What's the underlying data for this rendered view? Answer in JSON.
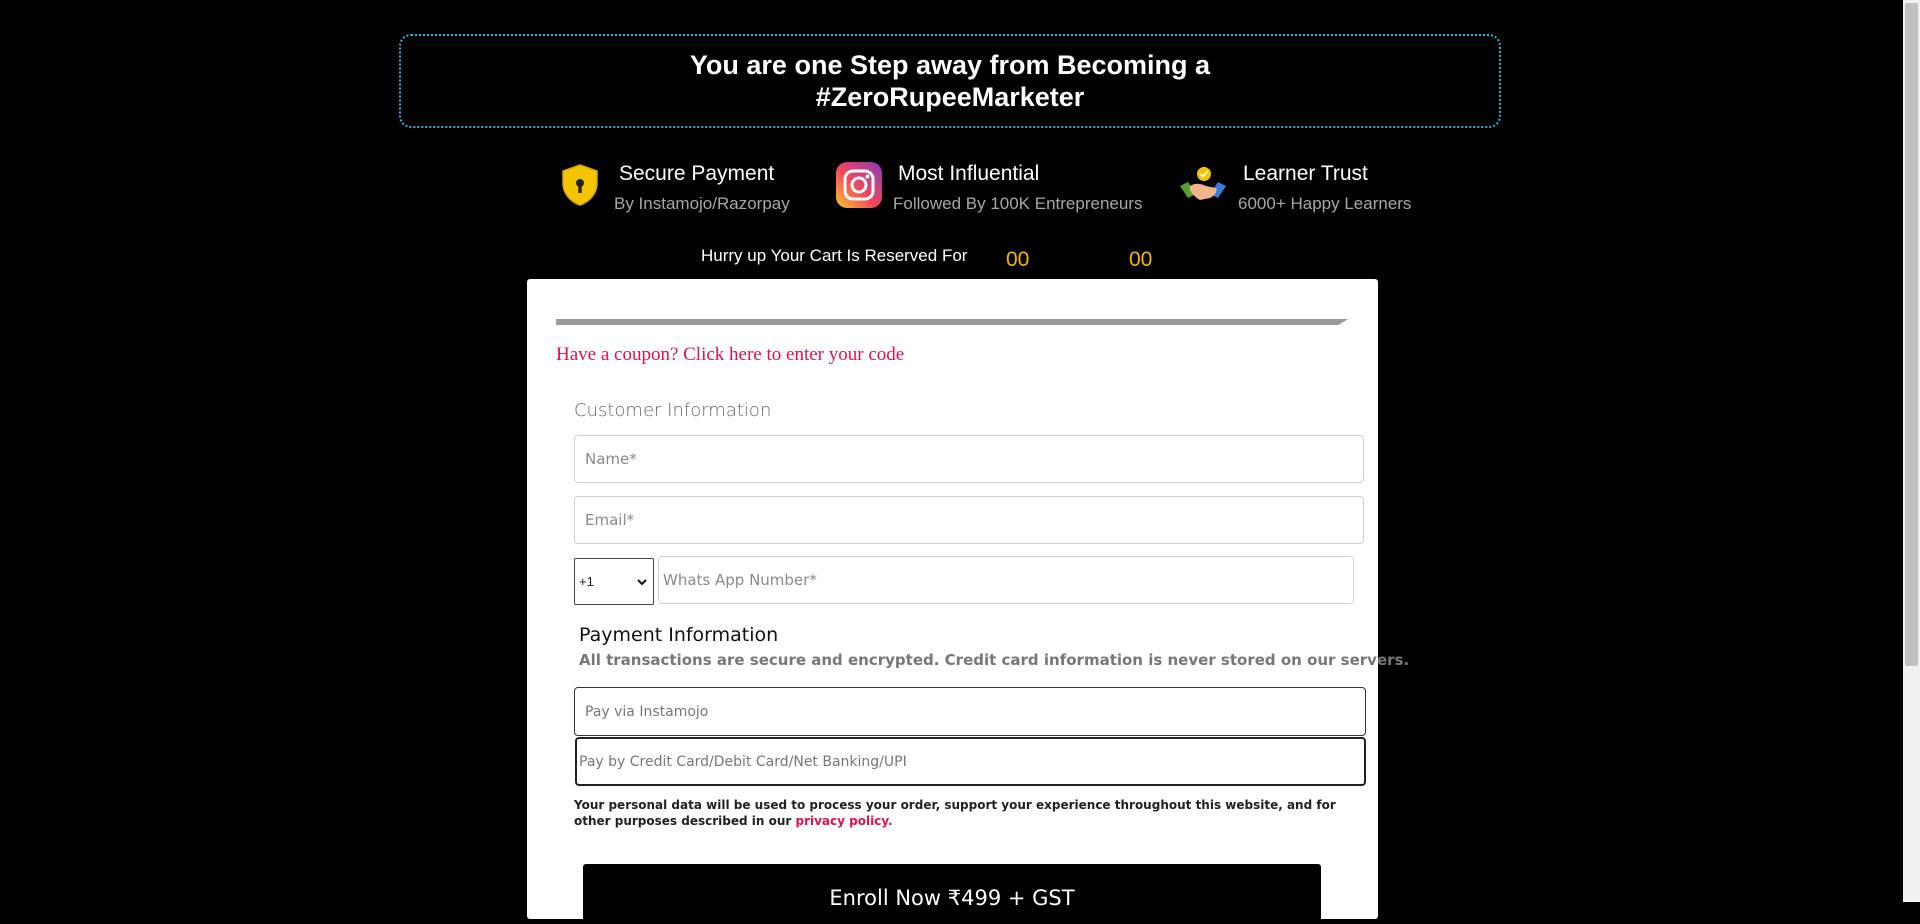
{
  "headline": {
    "line1": "You are one Step away from Becoming a",
    "line2": "#ZeroRupeeMarketer"
  },
  "badges": [
    {
      "icon": "shield-lock-icon",
      "title": "Secure Payment",
      "subtitle": "By Instamojo/Razorpay"
    },
    {
      "icon": "instagram-icon",
      "title": "Most Influential",
      "subtitle": "Followed By 100K Entrepreneurs"
    },
    {
      "icon": "handshake-icon",
      "title": "Learner Trust",
      "subtitle": "6000+ Happy Learners"
    }
  ],
  "timer": {
    "label": "Hurry up Your Cart Is Reserved For",
    "minutes": "00",
    "seconds": "00"
  },
  "coupon_text": "Have a coupon? Click here to enter your code",
  "customer": {
    "title": "Customer Information",
    "name_placeholder": "Name*",
    "email_placeholder": "Email*",
    "country_code": "+1",
    "whatsapp_placeholder": "Whats App Number*"
  },
  "payment": {
    "title": "Payment Information",
    "subtitle": "All transactions are secure and encrypted. Credit card information is never stored on our servers.",
    "option1": "Pay via Instamojo",
    "option2": "Pay by Credit Card/Debit Card/Net Banking/UPI"
  },
  "privacy": {
    "text": "Your personal data will be used to process your order, support your experience throughout this website, and for other purposes described in our",
    "link": "privacy policy."
  },
  "enroll_label": "Enroll Now ₹499 + GST",
  "colors": {
    "accent_pink": "#e0114e",
    "timer_yellow": "#f7b500",
    "headline_border": "#29b8e0"
  }
}
